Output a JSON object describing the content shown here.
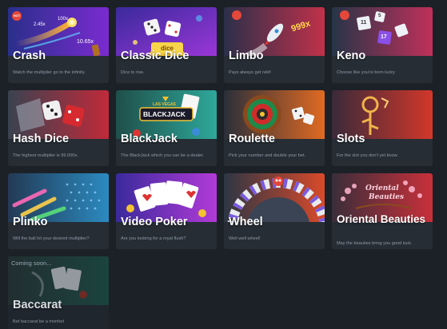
{
  "colors": {
    "page_bg": "#1c2127",
    "card_bg": "#262d35",
    "title": "#ffffff",
    "desc": "#8f9aa6",
    "badge": "#e4483a"
  },
  "games": [
    {
      "title": "Crash",
      "desc": "Watch the multiplier go to the infinity.",
      "art_text": [
        "2.45x",
        "100x",
        "10.65x"
      ],
      "badge": "HOT"
    },
    {
      "title": "Classic Dice",
      "desc": "Dice to rise.",
      "art_text": [
        "dice"
      ],
      "badge": ""
    },
    {
      "title": "Limbo",
      "desc": "Pays always get rekt!",
      "art_text": [
        "999x"
      ],
      "badge": ""
    },
    {
      "title": "Keno",
      "desc": "Choose like you're born lucky",
      "art_text": [
        "11",
        "5",
        "17"
      ],
      "badge": ""
    },
    {
      "title": "Hash Dice",
      "desc": "The highest multiplier is 99.000x.",
      "art_text": [],
      "badge": ""
    },
    {
      "title": "BlackJack",
      "desc": "The BlackJack which you can be a dealer.",
      "art_text": [
        "LAS VEGAS",
        "BLACKJACK"
      ],
      "badge": ""
    },
    {
      "title": "Roulette",
      "desc": "Pick your number and double your bet.",
      "art_text": [],
      "badge": ""
    },
    {
      "title": "Slots",
      "desc": "For the slot you don't yet know.",
      "art_text": [],
      "badge": ""
    },
    {
      "title": "Plinko",
      "desc": "Will the ball hit your desired multiplier?",
      "art_text": [],
      "badge": ""
    },
    {
      "title": "Video Poker",
      "desc": "Are you looking for a royal flush?",
      "art_text": [],
      "badge": ""
    },
    {
      "title": "Wheel",
      "desc": "Well well wheel!",
      "art_text": [],
      "badge": ""
    },
    {
      "title": "Oriental Beauties",
      "desc": "May the beauties bring you good luck.",
      "art_text": [
        "Oriental",
        "Beauties"
      ],
      "badge": ""
    },
    {
      "title": "Baccarat",
      "desc": "Bet baccarat be a monhet",
      "art_text": [],
      "badge": "",
      "status": "Coming soon..."
    }
  ]
}
